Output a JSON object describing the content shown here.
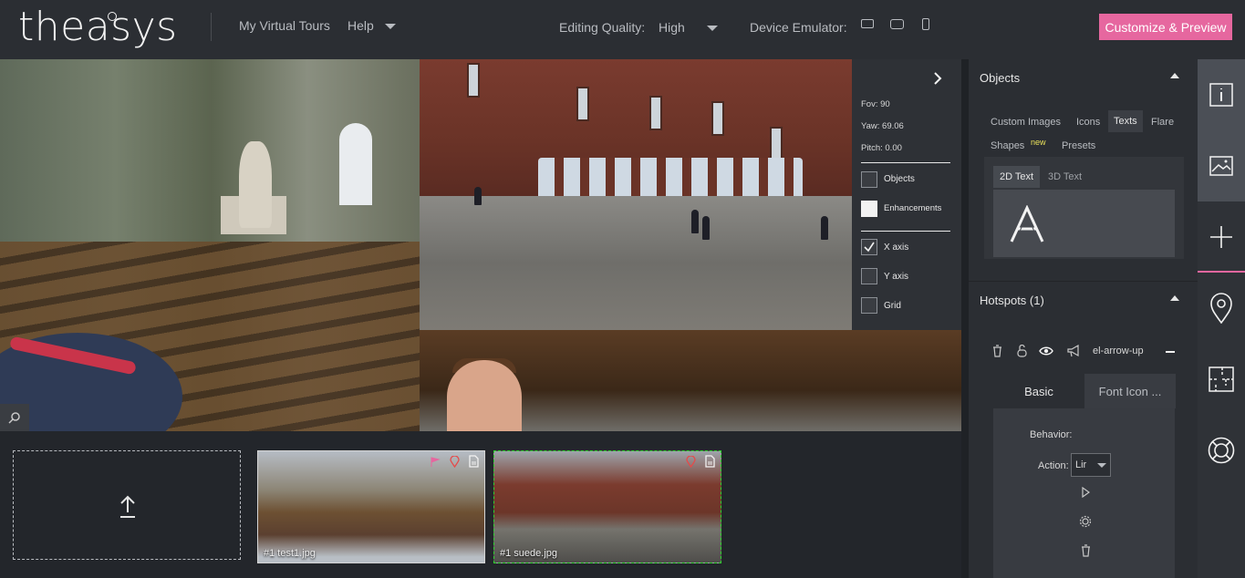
{
  "app": {
    "logo_text": "theasys",
    "nav": {
      "my_tours": "My Virtual Tours",
      "help": "Help"
    },
    "editing_quality": {
      "label": "Editing Quality:",
      "value": "High"
    },
    "device_emulator": {
      "label": "Device Emulator:",
      "icons": [
        "desktop-icon",
        "tablet-icon",
        "phone-icon"
      ]
    },
    "cta_label": "Customize & Preview",
    "accent_color": "#e6679f"
  },
  "viewer_panel": {
    "fov": "Fov: 90",
    "yaw": "Yaw: 69.06",
    "pitch": "Pitch: 0.00",
    "toggles": [
      {
        "label": "Objects",
        "checked": false
      },
      {
        "label": "Enhancements",
        "checked": false
      },
      {
        "label": "X axis",
        "checked": true
      },
      {
        "label": "Y axis",
        "checked": false
      },
      {
        "label": "Grid",
        "checked": false
      }
    ]
  },
  "scenes": [
    {
      "label": "#1 test1.jpg"
    },
    {
      "label": "#1 suede.jpg"
    }
  ],
  "objects_section": {
    "title": "Objects",
    "tabs": [
      "Custom Images",
      "Icons",
      "Texts",
      "Flare",
      "Shapes",
      "Presets"
    ],
    "active_tab": "Texts",
    "new_badge": "new",
    "subtabs": [
      "2D Text",
      "3D Text"
    ],
    "tile_glyph": "A"
  },
  "hotspots_section": {
    "title": "Hotspots (1)",
    "hotspot_name": "el-arrow-up",
    "tabs": [
      "Basic",
      "Font Icon ..."
    ],
    "behavior_label": "Behavior:",
    "action_label": "Action:",
    "action_value": "Lir"
  }
}
